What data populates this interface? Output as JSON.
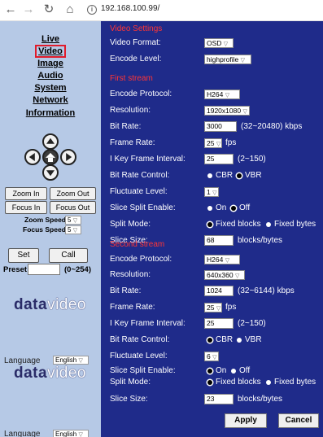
{
  "browser": {
    "url": "192.168.100.99/"
  },
  "sidebar": {
    "nav": [
      {
        "label": "Live",
        "active": false
      },
      {
        "label": "Video",
        "active": true
      },
      {
        "label": "Image",
        "active": false
      },
      {
        "label": "Audio",
        "active": false
      },
      {
        "label": "System",
        "active": false
      },
      {
        "label": "Network",
        "active": false
      },
      {
        "label": "Information",
        "active": false
      }
    ],
    "zoom_in": "Zoom In",
    "zoom_out": "Zoom Out",
    "focus_in": "Focus In",
    "focus_out": "Focus Out",
    "zoom_speed_label": "Zoom Speed",
    "zoom_speed_value": "5",
    "focus_speed_label": "Focus Speed",
    "focus_speed_value": "5",
    "set": "Set",
    "call": "Call",
    "preset_label": "Preset",
    "preset_value": "",
    "preset_range": "(0~254)",
    "logo_a": "data",
    "logo_b": "video",
    "language_label": "Language",
    "language_value": "English"
  },
  "video_settings": {
    "title": "Video Settings",
    "format_label": "Video Format:",
    "format_value": "OSD",
    "encode_label": "Encode Level:",
    "encode_value": "highprofile"
  },
  "first_stream": {
    "title": "First stream",
    "protocol_label": "Encode Protocol:",
    "protocol_value": "H264",
    "resolution_label": "Resolution:",
    "resolution_value": "1920x1080",
    "bitrate_label": "Bit Rate:",
    "bitrate_value": "3000",
    "bitrate_range": "(32~20480) kbps",
    "framerate_label": "Frame Rate:",
    "framerate_value": "25",
    "framerate_unit": "fps",
    "iframe_label": "I Key Frame Interval:",
    "iframe_value": "25",
    "iframe_range": "(2~150)",
    "bitrate_control_label": "Bit Rate Control:",
    "cbr": "CBR",
    "vbr": "VBR",
    "bitrate_control_value": "VBR",
    "fluctuate_label": "Fluctuate Level:",
    "fluctuate_value": "1",
    "slice_enable_label": "Slice Split Enable:",
    "on": "On",
    "off": "Off",
    "slice_enable_value": "Off",
    "split_mode_label": "Split Mode:",
    "fixed_blocks": "Fixed blocks",
    "fixed_bytes": "Fixed bytes",
    "split_mode_value": "Fixed blocks",
    "slice_size_label": "Slice Size:",
    "slice_size_value": "68",
    "slice_size_unit": "blocks/bytes"
  },
  "second_stream": {
    "title": "Second stream",
    "protocol_label": "Encode Protocol:",
    "protocol_value": "H264",
    "resolution_label": "Resolution:",
    "resolution_value": "640x360",
    "bitrate_label": "Bit Rate:",
    "bitrate_value": "1024",
    "bitrate_range": "(32~6144) kbps",
    "framerate_label": "Frame Rate:",
    "framerate_value": "25",
    "framerate_unit": "fps",
    "iframe_label": "I Key Frame Interval:",
    "iframe_value": "25",
    "iframe_range": "(2~150)",
    "bitrate_control_label": "Bit Rate Control:",
    "cbr": "CBR",
    "vbr": "VBR",
    "bitrate_control_value": "CBR",
    "fluctuate_label": "Fluctuate Level:",
    "fluctuate_value": "6",
    "slice_enable_label": "Slice Split Enable:",
    "on": "On",
    "off": "Off",
    "slice_enable_value": "On",
    "split_mode_label": "Split Mode:",
    "fixed_blocks": "Fixed blocks",
    "fixed_bytes": "Fixed bytes",
    "split_mode_value": "Fixed blocks",
    "slice_size_label": "Slice Size:",
    "slice_size_value": "23",
    "slice_size_unit": "blocks/bytes"
  },
  "actions": {
    "apply": "Apply",
    "cancel": "Cancel"
  },
  "colors": {
    "panel": "#1f2b8a",
    "sidebar": "#b6c9e6",
    "section_title": "#ff3535",
    "active_border": "#e01c2c"
  }
}
